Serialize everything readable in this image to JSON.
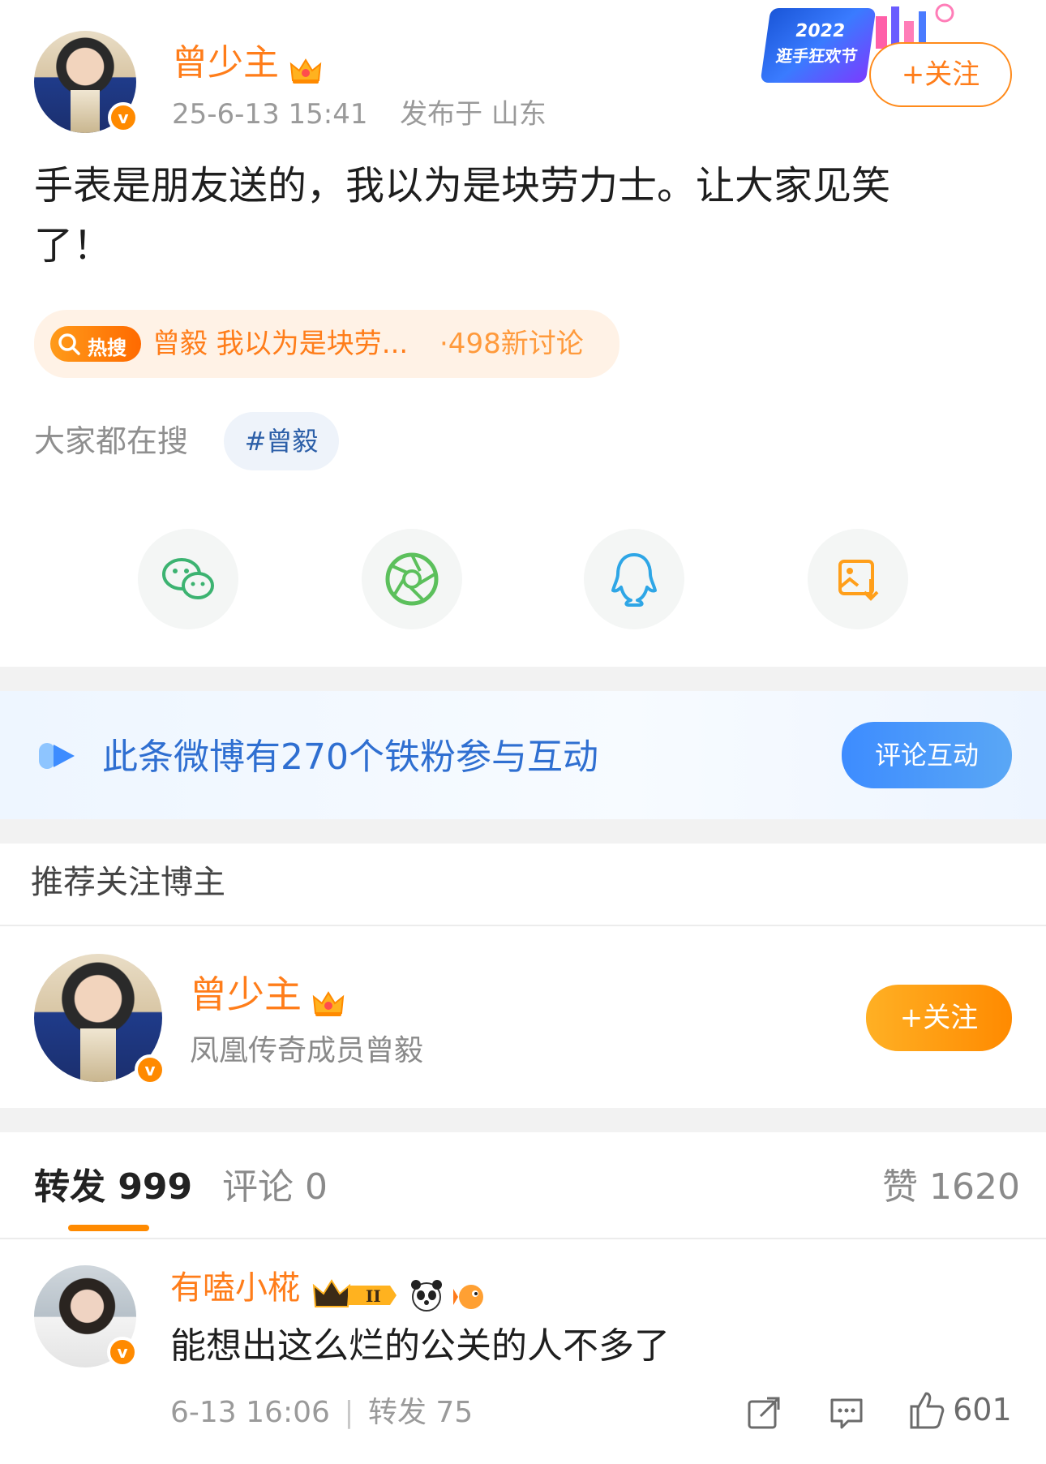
{
  "post": {
    "author_name": "曾少主",
    "meta_time": "25-6-13 15:41",
    "meta_location": "发布于 山东",
    "follow_label": "+关注",
    "banner_year": "2022",
    "banner_text": "逛手狂欢节",
    "content_line1": "手表是朋友送的，我以为是块劳力士。让大家见笑",
    "content_line2": "了！",
    "hot_search": {
      "tag": "热搜",
      "title": "曾毅 我以为是块劳...",
      "count": "·498新讨论"
    },
    "search_label": "大家都在搜",
    "topic": "#曾毅"
  },
  "share": {
    "items": [
      {
        "icon": "wechat-icon",
        "color": "#3cb371"
      },
      {
        "icon": "moments-icon",
        "color": "#5cc05c"
      },
      {
        "icon": "qq-icon",
        "color": "#2ea6e6"
      },
      {
        "icon": "save-image-icon",
        "color": "#ff9f1a"
      }
    ]
  },
  "fans_banner": {
    "text": "此条微博有270个铁粉参与互动",
    "button": "评论互动"
  },
  "recommend": {
    "section_title": "推荐关注博主",
    "name": "曾少主",
    "desc": "凤凰传奇成员曾毅",
    "follow_label": "+关注"
  },
  "tabs": {
    "repost": "转发 999",
    "comment": "评论 0",
    "like": "赞 1620"
  },
  "repost_item": {
    "name": "有嗑小椛",
    "text": "能想出这么烂的公关的人不多了",
    "time": "6-13 16:06",
    "repost": "转发 75",
    "likes": "601"
  },
  "colors": {
    "accent": "#ff8a00",
    "link_blue": "#2c5fa8"
  }
}
